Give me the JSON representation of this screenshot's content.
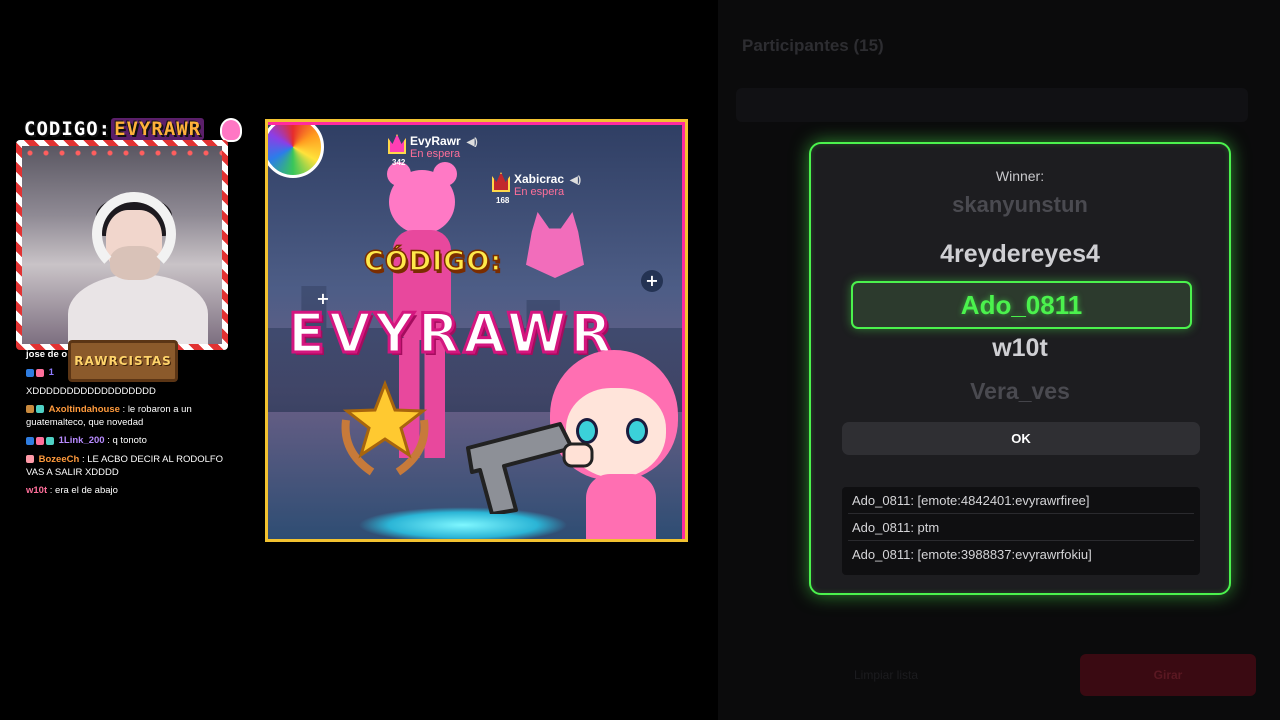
{
  "stream": {
    "webcam": {
      "code_prefix": "CODIGO:",
      "code_value": "EVYRAWR",
      "badge": "RAWRCISTAS"
    },
    "chat": [
      {
        "user": "jose de o",
        "message": "",
        "color": "#ffffff"
      },
      {
        "user": "1",
        "message": "",
        "color": "#8f7bff"
      },
      {
        "user": "",
        "message": "XDDDDDDDDDDDDDDDDDD",
        "color": "#ffffff"
      },
      {
        "user": "Axoltindahouse",
        "message": ": le robaron a un guatemalteco, que novedad",
        "color": "#ff9a3c"
      },
      {
        "user": "1Link_200",
        "message": ": q tonoto",
        "color": "#b88bff"
      },
      {
        "user": "BozeeCh",
        "message": ": LE ACBO DECIR AL RODOLFO VAS A SALIR XDDDD",
        "color": "#ff9a3c"
      },
      {
        "user": "w10t",
        "message": ": era el de abajo",
        "color": "#ff6f9a"
      }
    ]
  },
  "thumbnail": {
    "player1": {
      "name": "EvyRawr",
      "status": "En espera",
      "level": "342"
    },
    "player2": {
      "name": "Xabicrac",
      "status": "En espera",
      "level": "168"
    },
    "codigo_label": "CÓDIGO:",
    "code": "EVYRAWR"
  },
  "panel": {
    "title": "Participantes (15)",
    "footer_left": "Limpiar lista",
    "footer_button": "Girar"
  },
  "modal": {
    "winner_label": "Winner:",
    "wheel": {
      "faded_top": "skanyunstun",
      "upper": "4reydereyes4",
      "selected": "Ado_0811",
      "lower": "w10t",
      "faded_bottom": "Vera_ves"
    },
    "ok_label": "OK",
    "messages": [
      "Ado_0811: [emote:4842401:evyrawrfiree]",
      "Ado_0811: ptm",
      "Ado_0811: [emote:3988837:evyrawrfokiu]"
    ]
  },
  "colors": {
    "accent_green": "#4bf24d",
    "modal_bg": "#1d1d20",
    "thumb_border": "#f2c230"
  }
}
